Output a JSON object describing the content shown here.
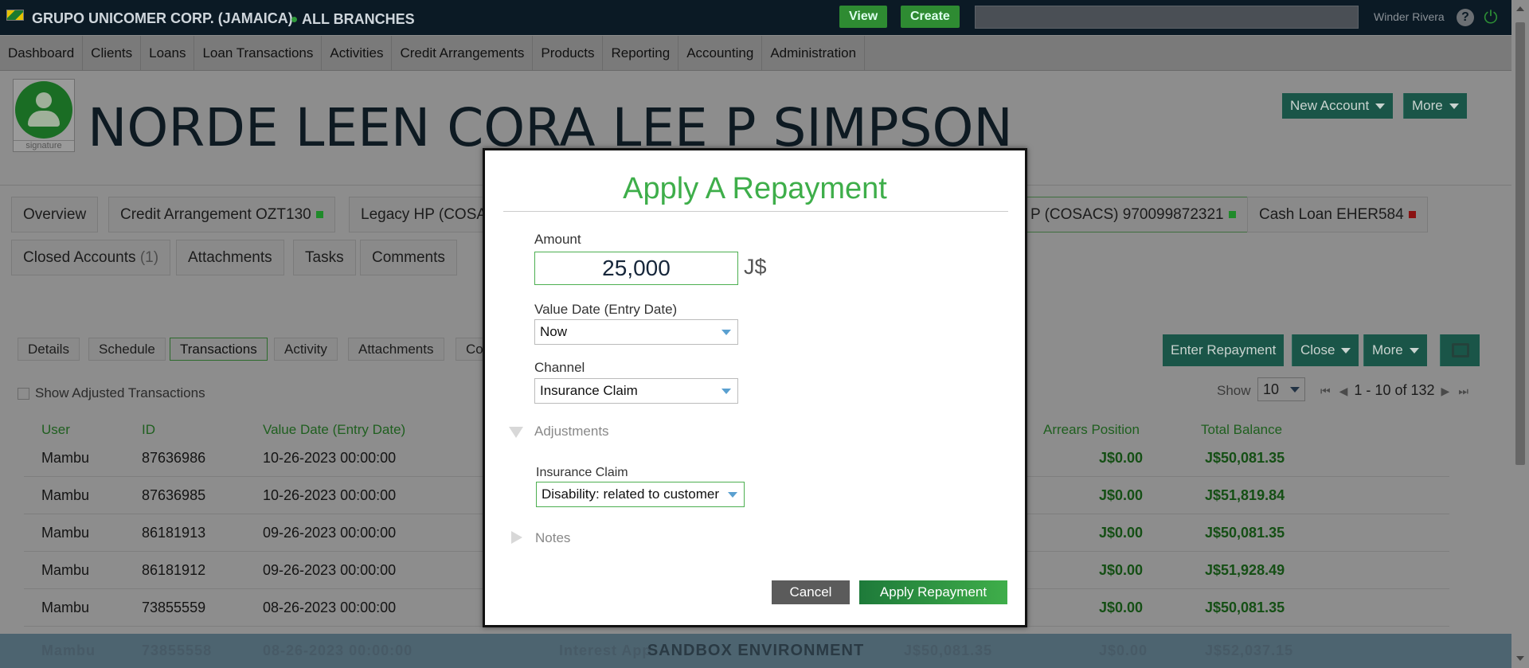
{
  "topbar": {
    "company": "GRUPO UNICOMER CORP. (JAMAICA)",
    "branch": "ALL BRANCHES",
    "view_label": "View",
    "create_label": "Create",
    "user": "Winder Rivera",
    "help_glyph": "?",
    "power_glyph": "⏻"
  },
  "nav": {
    "items": [
      "Dashboard",
      "Clients",
      "Loans",
      "Loan Transactions",
      "Activities",
      "Credit Arrangements",
      "Products",
      "Reporting",
      "Accounting",
      "Administration"
    ]
  },
  "client": {
    "name": "NORDE LEEN CORA LEE P SIMPSON",
    "signature_label": "signature",
    "new_account_label": "New Account",
    "more_label": "More"
  },
  "account_tabs": {
    "overview": "Overview",
    "credit_arrangement": "Credit Arrangement OZT130",
    "legacy_hp": "Legacy HP (COSA",
    "legacy_hp_active": "P (COSACS) 970099872321",
    "cash_loan": "Cash Loan EHER584",
    "closed_accounts": "Closed Accounts",
    "closed_count": "(1)",
    "attachments": "Attachments",
    "tasks": "Tasks",
    "comments": "Comments"
  },
  "sub_tabs": {
    "details": "Details",
    "schedule": "Schedule",
    "transactions": "Transactions",
    "activity": "Activity",
    "attachments": "Attachments",
    "co": "Co"
  },
  "actions": {
    "enter_repayment": "Enter Repayment",
    "close": "Close",
    "more": "More"
  },
  "list": {
    "show_adjusted": "Show Adjusted Transactions",
    "show_label": "Show",
    "page_size": "10",
    "range": "1 - 10 of 132",
    "headers": {
      "user": "User",
      "id": "ID",
      "value_date": "Value Date (Entry Date)",
      "arrears": "Arrears Position",
      "total": "Total Balance"
    },
    "rows": [
      {
        "user": "Mambu",
        "id": "87636986",
        "date": "10-26-2023 00:00:00",
        "arrears": "J$0.00",
        "total": "J$50,081.35"
      },
      {
        "user": "Mambu",
        "id": "87636985",
        "date": "10-26-2023 00:00:00",
        "arrears": "J$0.00",
        "total": "J$51,819.84"
      },
      {
        "user": "Mambu",
        "id": "86181913",
        "date": "09-26-2023 00:00:00",
        "arrears": "J$0.00",
        "total": "J$50,081.35"
      },
      {
        "user": "Mambu",
        "id": "86181912",
        "date": "09-26-2023 00:00:00",
        "arrears": "J$0.00",
        "total": "J$51,928.49"
      },
      {
        "user": "Mambu",
        "id": "73855559",
        "date": "08-26-2023 00:00:00",
        "arrears": "J$0.00",
        "total": "J$50,081.35"
      }
    ],
    "partial_row": {
      "user": "Mambu",
      "id": "73855558",
      "date": "08-26-2023 00:00:00",
      "type": "Interest App",
      "amount": "J$50,081.35",
      "arrears": "J$0.00",
      "total": "J$52,037.15"
    }
  },
  "sandbox": "SANDBOX ENVIRONMENT",
  "modal": {
    "title": "Apply A Repayment",
    "amount_label": "Amount",
    "amount_value": "25,000",
    "currency": "J$",
    "value_date_label": "Value Date (Entry Date)",
    "value_date_value": "Now",
    "channel_label": "Channel",
    "channel_value": "Insurance Claim",
    "adjustments_label": "Adjustments",
    "insurance_claim_label": "Insurance Claim",
    "insurance_claim_value": "Disability: related to customer",
    "notes_label": "Notes",
    "cancel_label": "Cancel",
    "apply_label": "Apply Repayment"
  },
  "colors": {
    "accent": "#3eae4a",
    "topbar": "#0b1a25",
    "dark_button": "#1a5548"
  }
}
